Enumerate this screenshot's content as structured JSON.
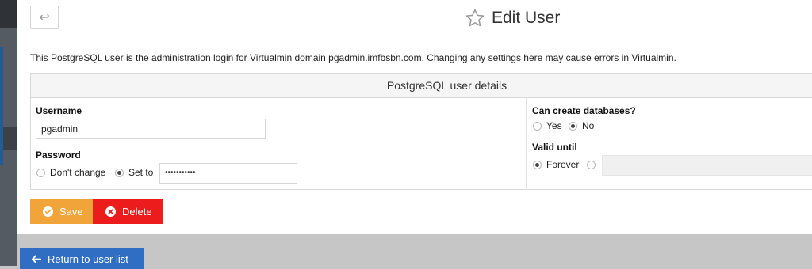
{
  "header": {
    "title": "Edit User",
    "back_icon": "back-arrow-icon",
    "star_icon": "star-outline-icon"
  },
  "notice": "This PostgreSQL user is the administration login for Virtualmin domain pgadmin.imfbsbn.com. Changing any settings here may cause errors in Virtualmin.",
  "details": {
    "heading": "PostgreSQL user details",
    "username": {
      "label": "Username",
      "value": "pgadmin"
    },
    "password": {
      "label": "Password",
      "option_dont_change": "Don't change",
      "option_set_to": "Set to",
      "selected": "Set to",
      "value": "•••••••••••"
    },
    "can_create_db": {
      "label": "Can create databases?",
      "option_yes": "Yes",
      "option_no": "No",
      "selected": "No"
    },
    "valid_until": {
      "label": "Valid until",
      "option_forever": "Forever",
      "selected": "Forever",
      "date_value": ""
    }
  },
  "actions": {
    "save": "Save",
    "delete": "Delete",
    "save_color": "#f0a43a",
    "delete_color": "#ec1c1c"
  },
  "footer": {
    "return_label": "Return to user list",
    "return_color": "#2f6ec3"
  }
}
